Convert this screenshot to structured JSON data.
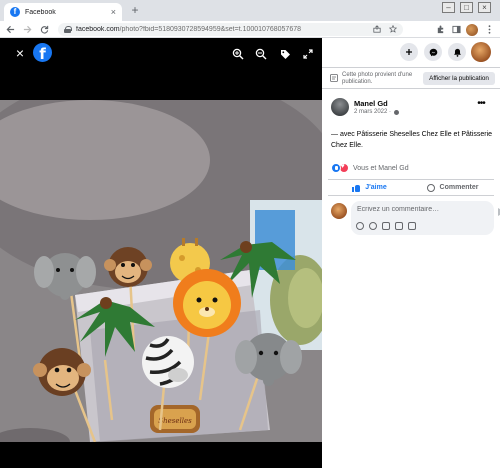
{
  "browser": {
    "tab_title": "Facebook",
    "tab_favicon": "f",
    "tab_close": "×",
    "new_tab": "+",
    "url_host": "facebook.com",
    "url_rest": "/photo?fbid=5180930728594959&set=t.100010768057678",
    "win_min": "–",
    "win_max": "□",
    "win_close": "×"
  },
  "viewer": {
    "close_icon_text": "×",
    "fb_logo_text": "f"
  },
  "panel": {
    "notice_text": "Cette photo provient d'une publication.",
    "notice_button": "Afficher la publication",
    "author": "Manel Gd",
    "date": "2 mars 2022 ·",
    "more": "•••",
    "post_text": "— avec Pâtisserie Sheselles Chez Elle et Pâtisserie Chez Elle.",
    "reaction_text": "Vous et Manel Gd",
    "like_label": "J'aime",
    "comment_label": "Commenter",
    "comment_placeholder": "Écrivez un commentaire…"
  },
  "photo_description_labels": {
    "box_text": "Sheselles"
  },
  "colors": {
    "fb_blue": "#1877f2",
    "love_red": "#f33e58",
    "viewer_bg": "#000000"
  },
  "icons": [
    "favicon-icon",
    "close-icon",
    "back-icon",
    "forward-icon",
    "reload-icon",
    "lock-icon",
    "share-icon",
    "star-icon",
    "extensions-icon",
    "sidepanel-icon",
    "zoom-in-icon",
    "zoom-out-icon",
    "tag-icon",
    "fullscreen-icon",
    "plus-icon",
    "messenger-icon",
    "bell-icon",
    "globe-icon"
  ]
}
